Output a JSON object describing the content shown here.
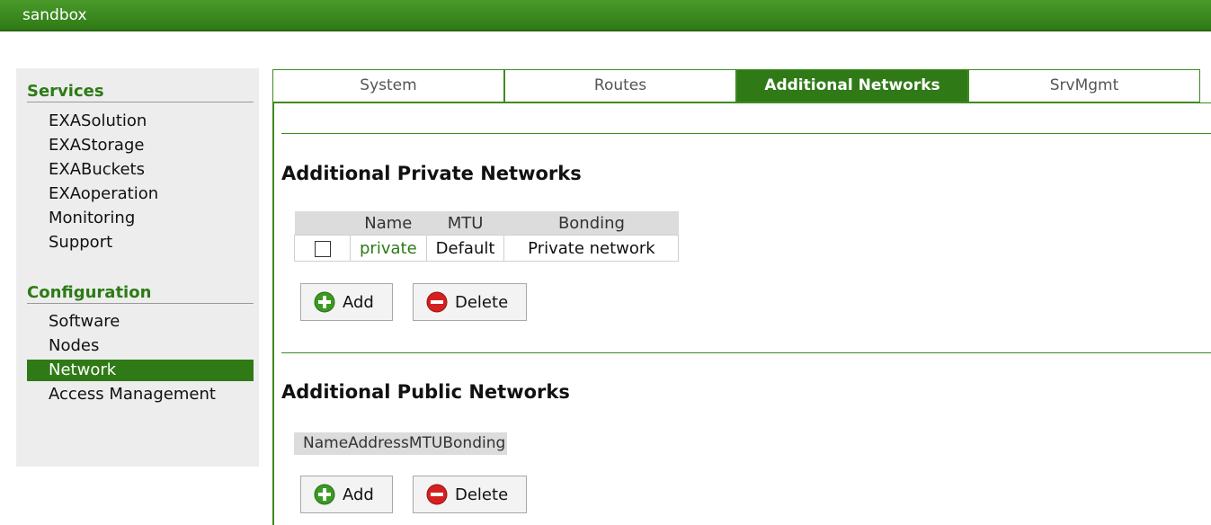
{
  "app": {
    "title": "sandbox"
  },
  "sidebar": {
    "services_heading": "Services",
    "services": [
      "EXASolution",
      "EXAStorage",
      "EXABuckets",
      "EXAoperation",
      "Monitoring",
      "Support"
    ],
    "configuration_heading": "Configuration",
    "configuration": [
      "Software",
      "Nodes",
      "Network",
      "Access Management"
    ],
    "active_item": "Network"
  },
  "tabs": [
    "System",
    "Routes",
    "Additional Networks",
    "SrvMgmt"
  ],
  "active_tab": "Additional Networks",
  "private_networks": {
    "heading": "Additional Private Networks",
    "columns": [
      "",
      "Name",
      "MTU",
      "Bonding"
    ],
    "rows": [
      {
        "checked": false,
        "name": "private",
        "mtu": "Default",
        "bonding": "Private network"
      }
    ],
    "add_label": "Add",
    "delete_label": "Delete"
  },
  "public_networks": {
    "heading": "Additional Public Networks",
    "columns": [
      "Name",
      "Address",
      "MTU",
      "Bonding"
    ],
    "add_label": "Add",
    "delete_label": "Delete"
  },
  "colors": {
    "brand_green": "#2f7a16",
    "add_icon": "#3a9a22",
    "delete_icon": "#d42020"
  }
}
